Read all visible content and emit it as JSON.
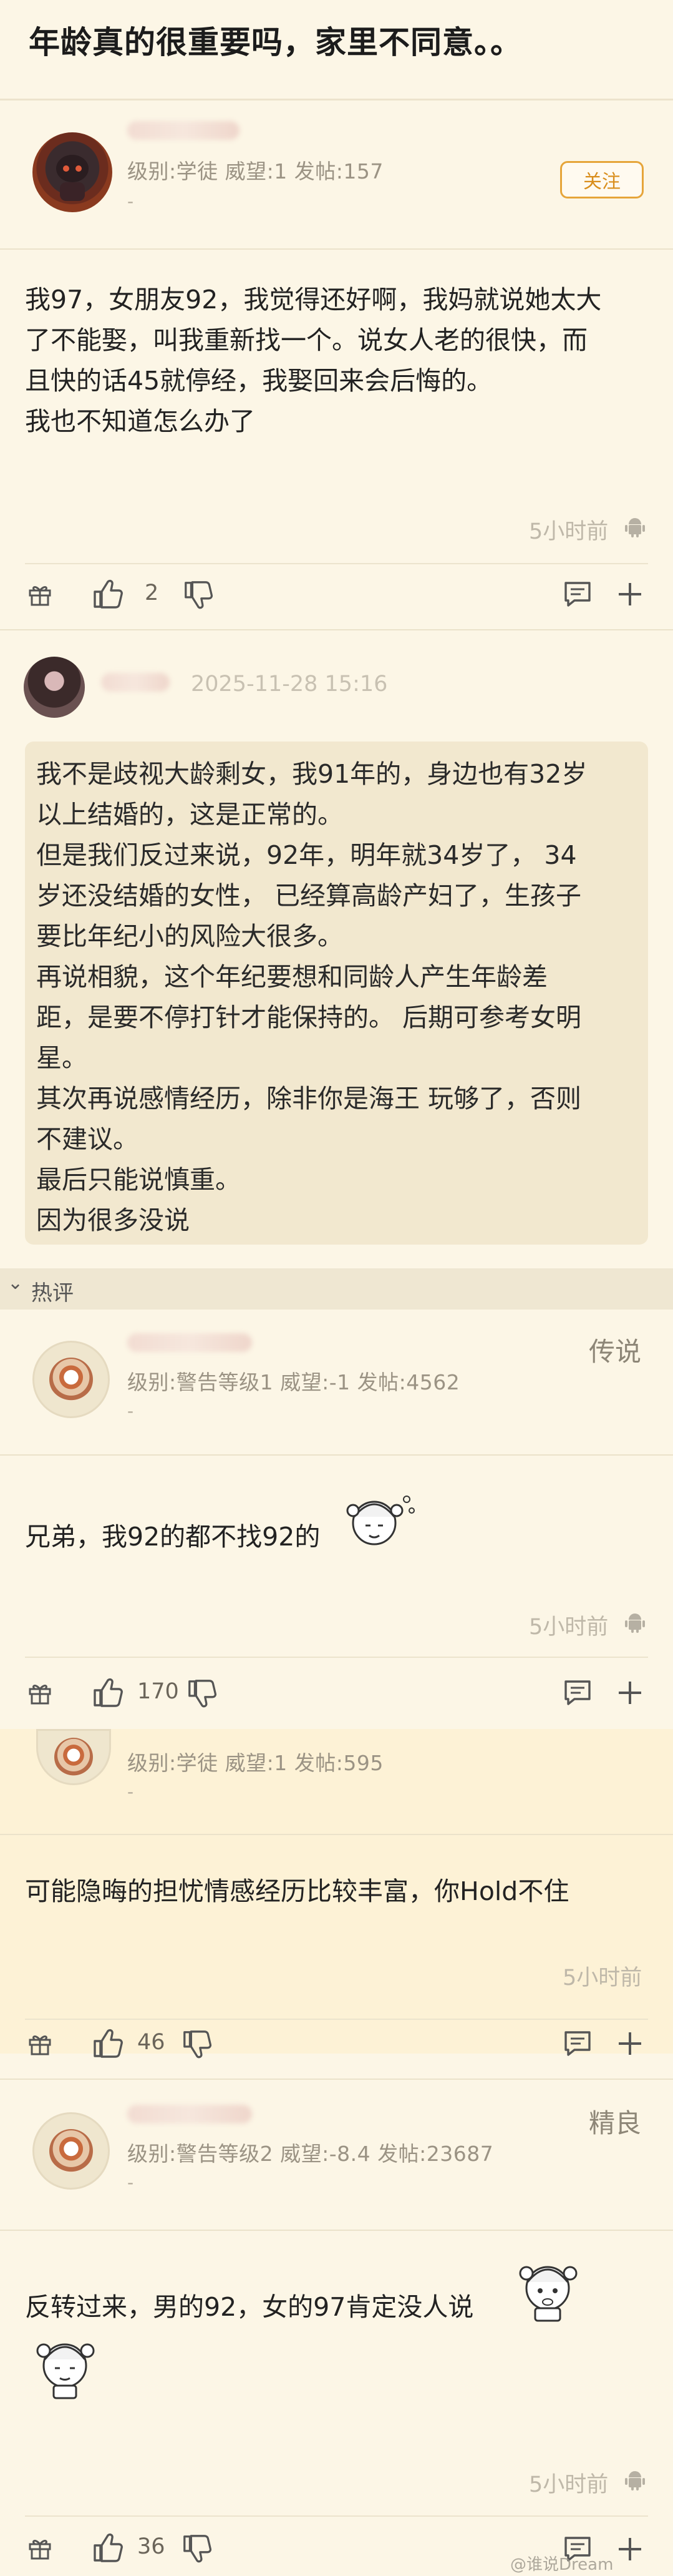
{
  "thread": {
    "title": "年龄真的很重要吗，家里不同意。。"
  },
  "post": {
    "meta": "级别:学徒 威望:1 发帖:157",
    "dash": "-",
    "follow_label": "关注",
    "body_lines": [
      "我97，女朋友92，我觉得还好啊，我妈就说她太大",
      "了不能娶，叫我重新找一个。说女人老的很快，而",
      "且快的话45就停经，我娶回来会后悔的。",
      "我也不知道怎么办了"
    ],
    "time": "5小时前",
    "likes": "2"
  },
  "quoted_reply": {
    "date": "2025-11-28 15:16",
    "lines": [
      "我不是歧视大龄剩女，我91年的，身边也有32岁",
      "以上结婚的，这是正常的。",
      "但是我们反过来说，92年，明年就34岁了， 34",
      "岁还没结婚的女性， 已经算高龄产妇了，生孩子",
      "要比年纪小的风险大很多。",
      "再说相貌，这个年纪要想和同龄人产生年龄差",
      "距，是要不停打针才能保持的。 后期可参考女明",
      "星。",
      "其次再说感情经历，除非你是海王 玩够了，否则",
      "不建议。",
      "最后只能说慎重。",
      "因为很多没说"
    ]
  },
  "hot_section": {
    "label": "热评",
    "chevron": "⌄"
  },
  "comments": [
    {
      "tag": "传说",
      "meta": "级别:警告等级1 威望:-1 发帖:4562",
      "dash": "-",
      "text": "兄弟，我92的都不找92的",
      "time": "5小时前",
      "likes": "170"
    },
    {
      "tag": "",
      "meta": "级别:学徒 威望:1 发帖:595",
      "dash": "-",
      "text": "可能隐晦的担忧情感经历比较丰富，你Hold不住",
      "time": "5小时前",
      "likes": "46"
    },
    {
      "tag": "精良",
      "meta": "级别:警告等级2 威望:-8.4 发帖:23687",
      "dash": "-",
      "text": "反转过来，男的92，女的97肯定没人说",
      "time": "5小时前",
      "likes": "36"
    }
  ],
  "watermark": "@谁说Dream",
  "colors": {
    "background": "#fcf6e6",
    "accent": "#e6a53a",
    "quote_bg": "#f2e8cf"
  },
  "icons": [
    "gift-icon",
    "thumbs-up-icon",
    "thumbs-down-icon",
    "comment-icon",
    "plus-icon",
    "android-icon"
  ]
}
